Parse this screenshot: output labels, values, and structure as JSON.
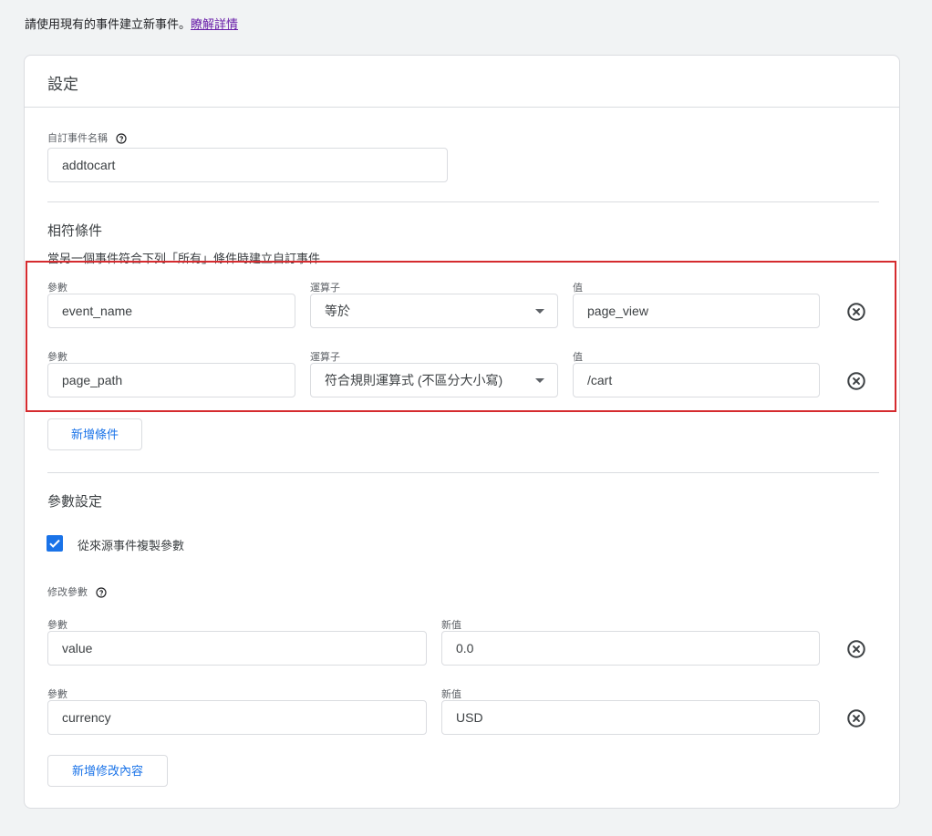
{
  "intro": {
    "text": "請使用現有的事件建立新事件。",
    "link": "瞭解詳情"
  },
  "card": {
    "title": "設定",
    "custom_event_name": {
      "label": "自訂事件名稱",
      "value": "addtocart",
      "help_icon": "help-circle-icon"
    },
    "matching": {
      "title": "相符條件",
      "subtitle": "當另一個事件符合下列「所有」條件時建立自訂事件",
      "conditions": [
        {
          "param_label": "參數",
          "param_value": "event_name",
          "operator_label": "運算子",
          "operator_value": "等於",
          "value_label": "值",
          "value": "page_view"
        },
        {
          "param_label": "參數",
          "param_value": "page_path",
          "operator_label": "運算子",
          "operator_value": "符合規則運算式 (不區分大小寫)",
          "value_label": "值",
          "value": "/cart"
        }
      ],
      "add_condition_label": "新增條件"
    },
    "param_settings": {
      "title": "參數設定",
      "copy_params_label": "從來源事件複製參數",
      "copy_params_checked": true,
      "modify_label": "修改參數",
      "modifications": [
        {
          "param_label": "參數",
          "param_value": "value",
          "new_value_label": "新值",
          "new_value": "0.0"
        },
        {
          "param_label": "參數",
          "param_value": "currency",
          "new_value_label": "新值",
          "new_value": "USD"
        }
      ],
      "add_modification_label": "新增修改內容"
    }
  },
  "colors": {
    "accent": "#1a73e8",
    "highlight_border": "#d52b2f",
    "link": "#681da8"
  }
}
